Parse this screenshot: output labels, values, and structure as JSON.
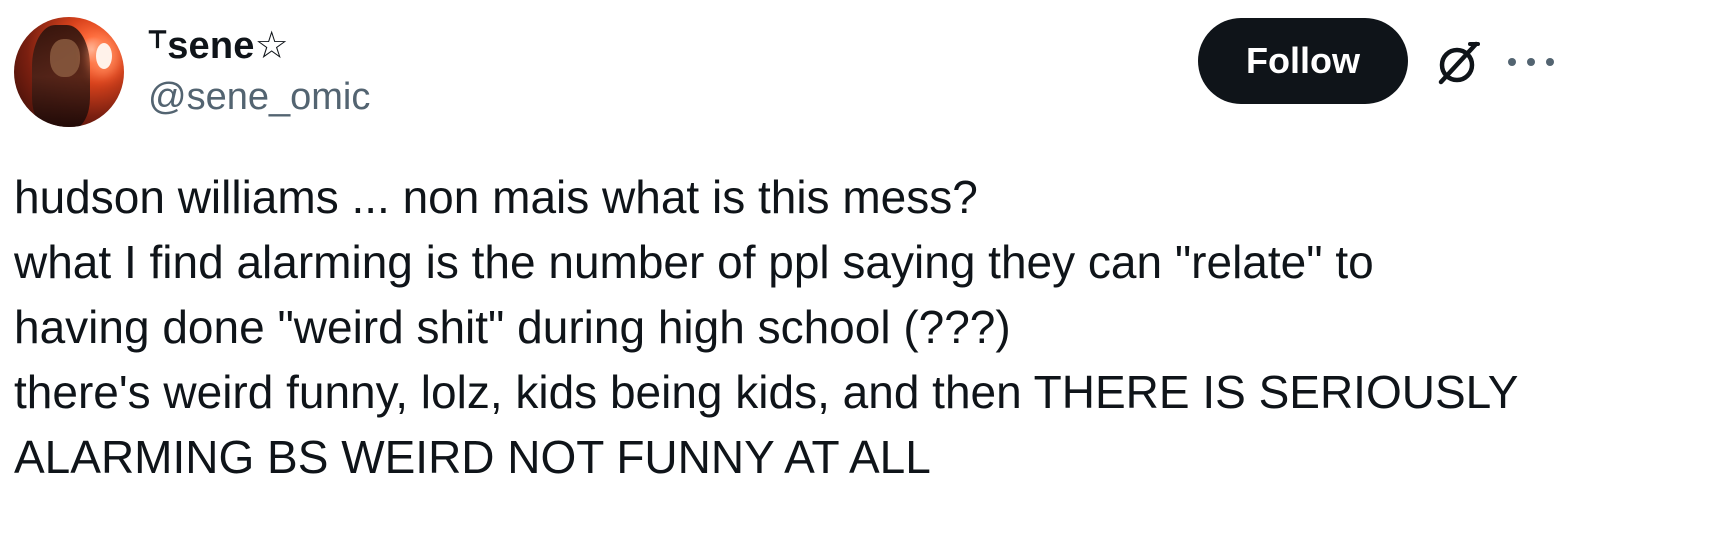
{
  "author": {
    "display_name": "⸆sene☆",
    "handle": "@sene_omic"
  },
  "actions": {
    "follow_label": "Follow",
    "grok_icon": "grok-icon",
    "more_icon": "more-icon"
  },
  "tweet": {
    "lines": [
      "hudson williams ... non mais what is this mess?",
      "what I find alarming is the number of ppl saying they can \"relate\" to",
      "having done \"weird shit\" during high school (???)",
      "there's weird funny, lolz, kids being kids, and then THERE IS SERIOUSLY",
      "ALARMING BS WEIRD NOT FUNNY AT ALL"
    ]
  },
  "colors": {
    "text_primary": "#0f1419",
    "text_secondary": "#536471",
    "button_bg": "#0f1419",
    "button_text": "#ffffff"
  }
}
